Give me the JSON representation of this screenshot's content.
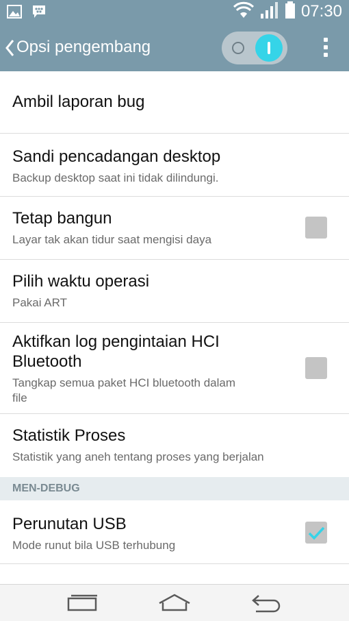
{
  "status_bar": {
    "time": "07:30",
    "icons": [
      "gallery-icon",
      "messenger-icon",
      "wifi-icon",
      "signal-icon",
      "battery-icon"
    ]
  },
  "action_bar": {
    "title": "Opsi pengembang",
    "toggle_state": "on",
    "accent_color": "#35d4e8"
  },
  "list": {
    "items": [
      {
        "title": "Ambil laporan bug",
        "subtitle": ""
      },
      {
        "title": "Sandi pencadangan desktop",
        "subtitle": "Backup desktop saat ini tidak dilindungi."
      },
      {
        "title": "Tetap bangun",
        "subtitle": "Layar tak akan tidur saat mengisi daya",
        "checked": false
      },
      {
        "title": "Pilih waktu operasi",
        "subtitle": "Pakai ART"
      },
      {
        "title_line1": "Aktifkan log pengintaian HCI",
        "title_line2": "Bluetooth",
        "subtitle_line1": "Tangkap semua paket HCI bluetooth dalam",
        "subtitle_line2": "file",
        "checked": false
      },
      {
        "title": "Statistik Proses",
        "subtitle": "Statistik yang aneh tentang proses yang berjalan"
      }
    ],
    "section_header": "MEN-DEBUG",
    "debug_items": [
      {
        "title": "Perunutan USB",
        "subtitle": "Mode runut bila USB terhubung",
        "checked": true
      }
    ]
  },
  "nav_bar": {
    "buttons": [
      "recent-apps-icon",
      "home-icon",
      "back-icon"
    ]
  }
}
